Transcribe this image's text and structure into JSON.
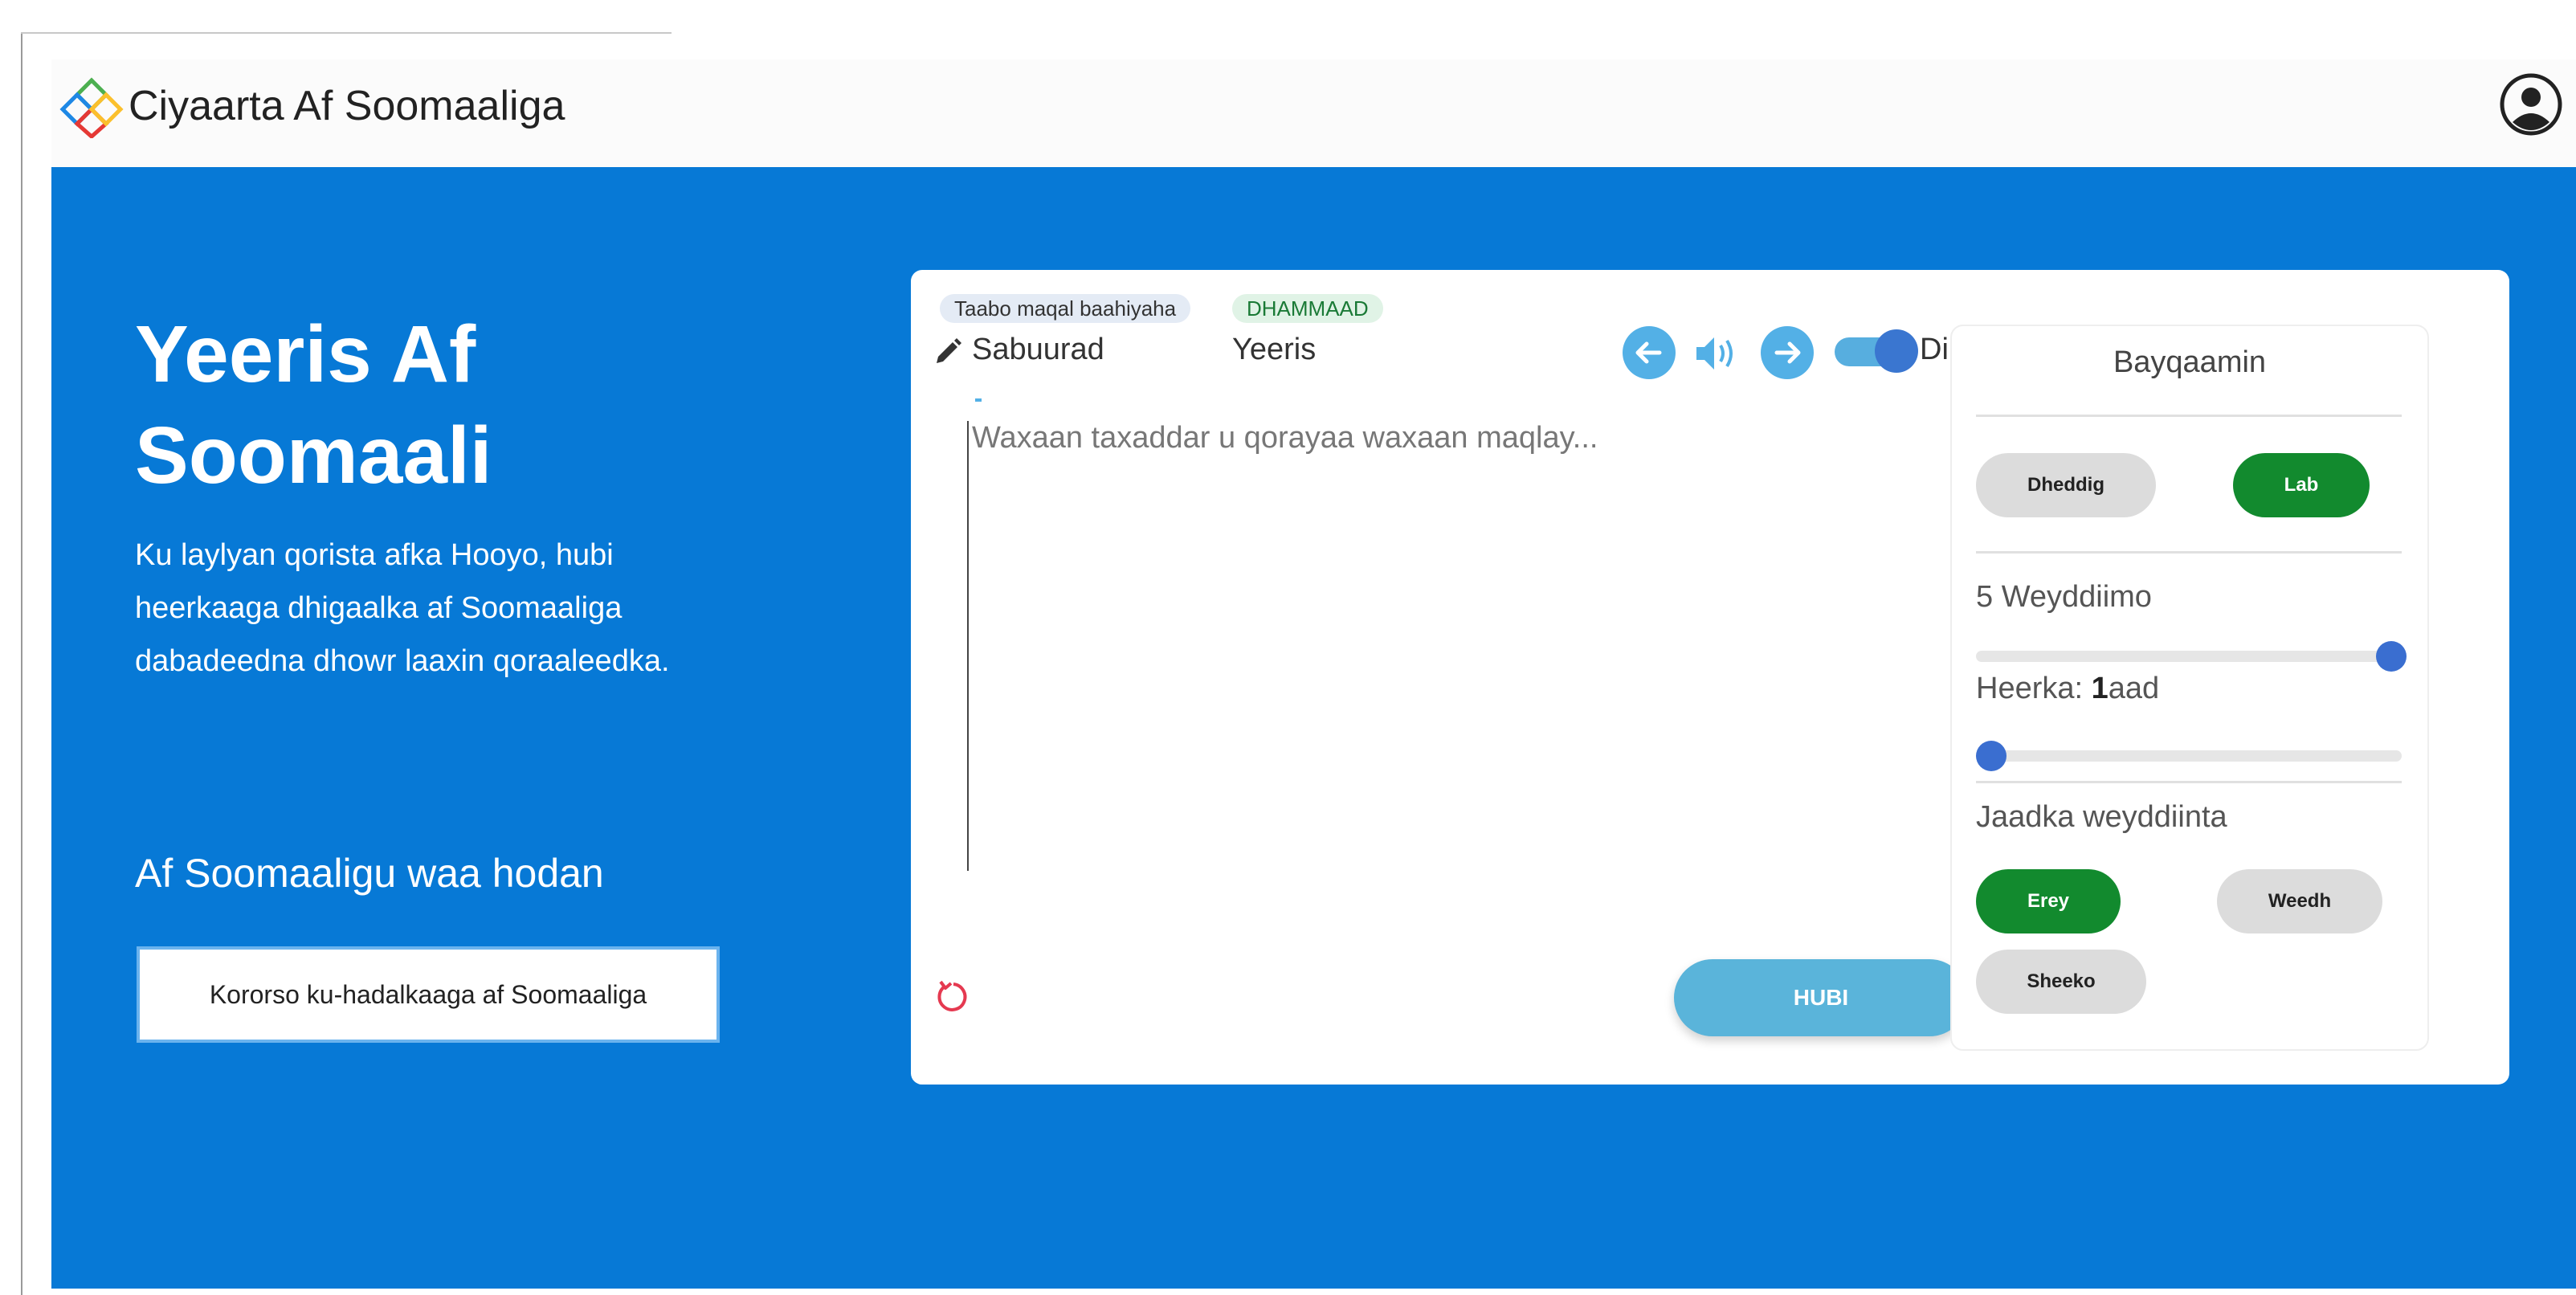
{
  "header": {
    "app_title": "Ciyaarta Af Soomaaliga",
    "logo_icon": "diamond-puzzle-logo",
    "profile_icon": "account-circle-icon"
  },
  "hero": {
    "title": "Yeeris Af Soomaali",
    "description": "Ku laylyan qorista afka Hooyo, hubi heerkaaga dhigaalka af Soomaaliga dabadeedna dhowr laaxin qoraaleedka.",
    "slogan": "Af Soomaaligu waa hodan",
    "cta_label": "Kororso ku-hadalkaaga af Soomaaliga",
    "background_color": "#0779d6"
  },
  "exercise": {
    "hint_badge": "Taabo maqal baahiyaha",
    "all_badge": "DHAMMAAD",
    "tabs": [
      {
        "label": "Sabuurad",
        "icon": "pencil-icon",
        "active": true
      },
      {
        "label": "Yeeris",
        "active": false
      }
    ],
    "prev_icon": "arrow-left-icon",
    "speaker_icon": "speaker-icon",
    "next_icon": "arrow-right-icon",
    "toggle": {
      "label": "Diin",
      "on": true
    },
    "answer_placeholder": "Waxaan taxaddar u qorayaa waxaan maqlay...",
    "answer_value": "",
    "reset_icon": "refresh-icon",
    "check_label": "HUBI"
  },
  "settings": {
    "title": "Bayqaamin",
    "modes": [
      {
        "label": "Dheddig",
        "selected": false
      },
      {
        "label": "Lab",
        "selected": true
      }
    ],
    "questions_label": "5 Weyddiimo",
    "questions_slider": {
      "value": 5,
      "fraction": 1.0
    },
    "level_label_prefix": "Heerka: ",
    "level_number": "1",
    "level_suffix": "aad",
    "level_slider": {
      "value": 1,
      "fraction": 0.0
    },
    "question_type_label": "Jaadka weyddiinta",
    "question_types": [
      {
        "label": "Erey",
        "selected": true
      },
      {
        "label": "Weedh",
        "selected": false
      },
      {
        "label": "Sheeko",
        "selected": false
      }
    ]
  },
  "colors": {
    "accent_blue": "#53b0e6",
    "check_button": "#5ab4da",
    "selected_green": "#128a2e",
    "slider_knob": "#3a6ed0"
  }
}
